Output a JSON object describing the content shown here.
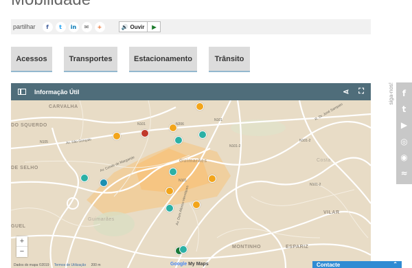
{
  "page": {
    "title": "Mobilidade"
  },
  "share": {
    "label": "partilhar",
    "icons": [
      {
        "name": "facebook",
        "glyph": "f",
        "color": "#3b5998"
      },
      {
        "name": "twitter",
        "glyph": "t",
        "color": "#1da1f2"
      },
      {
        "name": "linkedin",
        "glyph": "in",
        "color": "#0077b5"
      },
      {
        "name": "email",
        "glyph": "✉",
        "color": "#555555"
      },
      {
        "name": "more",
        "glyph": "+",
        "color": "#e96c29"
      }
    ],
    "listen_label": "Ouvir"
  },
  "tabs": [
    {
      "label": "Acessos"
    },
    {
      "label": "Transportes"
    },
    {
      "label": "Estacionamento"
    },
    {
      "label": "Trânsito"
    }
  ],
  "map": {
    "header_title": "Informação Útil",
    "places": [
      "CARVALHA",
      "DO SQUERDO",
      "DE SELHO",
      "GUEL",
      "VILAR",
      "MONTINHO",
      "ESPARIZ",
      "Guimarães",
      "Guimarães",
      "Costa"
    ],
    "roads": [
      "N105",
      "N101",
      "N206",
      "N101",
      "N101-2",
      "N101-2",
      "N101",
      "N101-2",
      "Av. São Gonçalo",
      "Av. Conde de Margaride",
      "Av. Dom Afonso Henriques",
      "R. Dr. José Sampaio"
    ],
    "zoom_in": "+",
    "zoom_out": "−",
    "attribution": [
      "Dados do mapa ©2019",
      "Termos de Utilização",
      "200 m"
    ],
    "google_label": "Google",
    "mymaps_label": "My Maps",
    "colors": {
      "header": "#4f6d7a",
      "bus": "#f2a51c",
      "train": "#2bb0a5",
      "parking": "#1c8fb1",
      "red": "#c0392b"
    }
  },
  "side_label": "siga-nos!",
  "social": [
    "facebook-icon",
    "twitter-icon",
    "youtube-icon",
    "instagram-icon",
    "foursquare-icon",
    "rss-icon"
  ],
  "social_glyphs": [
    "f",
    "t",
    "▶",
    "◎",
    "◉",
    "≈"
  ],
  "contact_label": "Contacte"
}
